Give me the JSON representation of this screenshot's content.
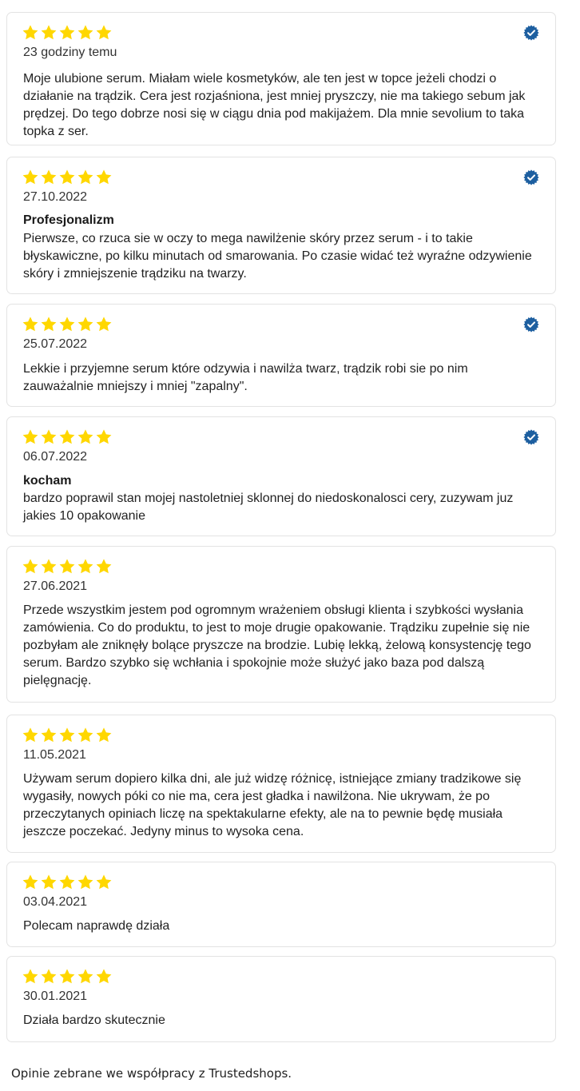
{
  "colors": {
    "star": "#ffd700",
    "verified_badge": "#1d5fa0",
    "border": "#e3e3e3"
  },
  "icons": {
    "rating": "star-icon",
    "verified": "verified-badge-icon"
  },
  "reviews": [
    {
      "rating": 5,
      "verified": true,
      "date": "23 godziny temu",
      "title": "",
      "text": "Moje ulubione serum. Miałam wiele kosmetyków, ale ten jest w topce jeżeli chodzi o działanie na trądzik. Cera jest rozjaśniona, jest mniej pryszczy, nie ma takiego sebum jak prędzej. Do tego dobrze nosi się w ciągu dnia pod makijażem. Dla mnie sevolium to taka topka z ser."
    },
    {
      "rating": 5,
      "verified": true,
      "date": "27.10.2022",
      "title": "Profesjonalizm",
      "text": "Pierwsze, co rzuca sie w oczy to mega nawilżenie skóry przez serum - i to takie błyskawiczne, po kilku minutach od smarowania. Po czasie widać też wyraźne odzywienie skóry i zmniejszenie trądziku na twarzy."
    },
    {
      "rating": 5,
      "verified": true,
      "date": "25.07.2022",
      "title": "",
      "text": "Lekkie i przyjemne serum które odzywia i nawilża twarz, trądzik robi sie po nim zauważalnie mniejszy i mniej \"zapalny\"."
    },
    {
      "rating": 5,
      "verified": true,
      "date": "06.07.2022",
      "title": "kocham",
      "text": "bardzo poprawil stan mojej nastoletniej sklonnej do niedoskonalosci cery, zuzywam juz jakies 10 opakowanie"
    },
    {
      "rating": 5,
      "verified": false,
      "date": "27.06.2021",
      "title": "",
      "text": "Przede wszystkim jestem pod ogromnym wrażeniem obsługi klienta i szybkości wysłania zamówienia. Co do produktu, to jest to moje drugie opakowanie. Trądziku zupełnie się nie pozbyłam ale zniknęły bolące pryszcze na brodzie. Lubię lekką, żelową konsystencję tego serum. Bardzo szybko się wchłania i spokojnie może służyć jako baza pod dalszą pielęgnację."
    },
    {
      "rating": 5,
      "verified": false,
      "date": "11.05.2021",
      "title": "",
      "text": "Używam serum dopiero kilka dni, ale już widzę różnicę, istniejące zmiany tradzikowe się wygasiły, nowych póki co nie ma, cera jest gładka i nawilżona. Nie ukrywam, że po przeczytanych opiniach liczę na spektakularne efekty, ale na to pewnie będę musiała jeszcze poczekać. Jedyny minus to wysoka cena."
    },
    {
      "rating": 5,
      "verified": false,
      "date": "03.04.2021",
      "title": "",
      "text": "Polecam naprawdę działa"
    },
    {
      "rating": 5,
      "verified": false,
      "date": "30.01.2021",
      "title": "",
      "text": "Działa bardzo skutecznie"
    }
  ],
  "footer": {
    "text": "Opinie zebrane we współpracy z Trustedshops."
  }
}
